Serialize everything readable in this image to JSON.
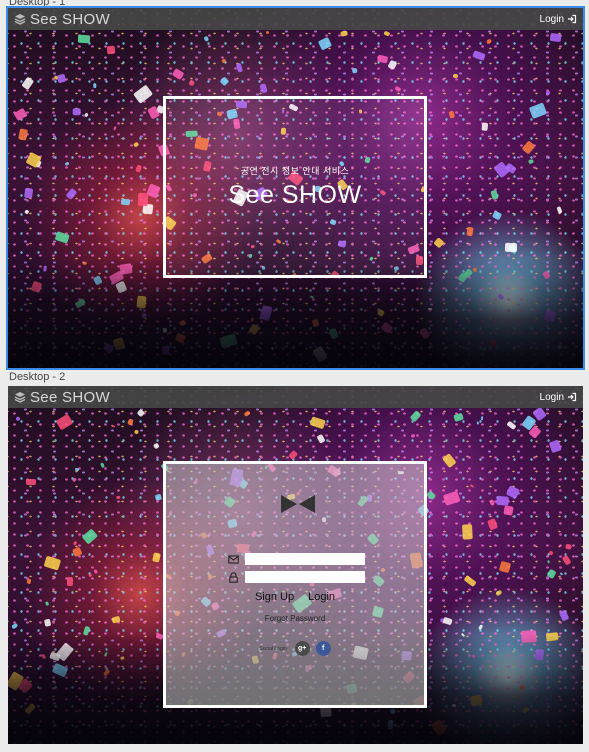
{
  "artboards": [
    {
      "label": "Desktop - 1",
      "brand": "See SHOW",
      "login_label": "Login",
      "hero": {
        "subtitle": "공연 전시 정보 안내 서비스",
        "title": "See SHOW"
      }
    },
    {
      "label": "Desktop - 2",
      "brand": "See SHOW",
      "login_label": "Login",
      "form": {
        "email_value": "",
        "password_value": "",
        "signup_label": "Sign Up",
        "login_label": "Login",
        "forgot_label": "Forgot Password",
        "social_label": "Social Login",
        "google_label": "g+",
        "facebook_label": "f"
      }
    }
  ],
  "icons": {
    "logo": "layers-icon",
    "login": "login-arrow-icon",
    "mail": "mail-icon",
    "lock": "lock-icon",
    "bowtie": "bowtie-logo-icon"
  },
  "colors": {
    "selection_outline": "#3b8be8",
    "topbar": "#464646",
    "facebook": "#3b5998"
  }
}
